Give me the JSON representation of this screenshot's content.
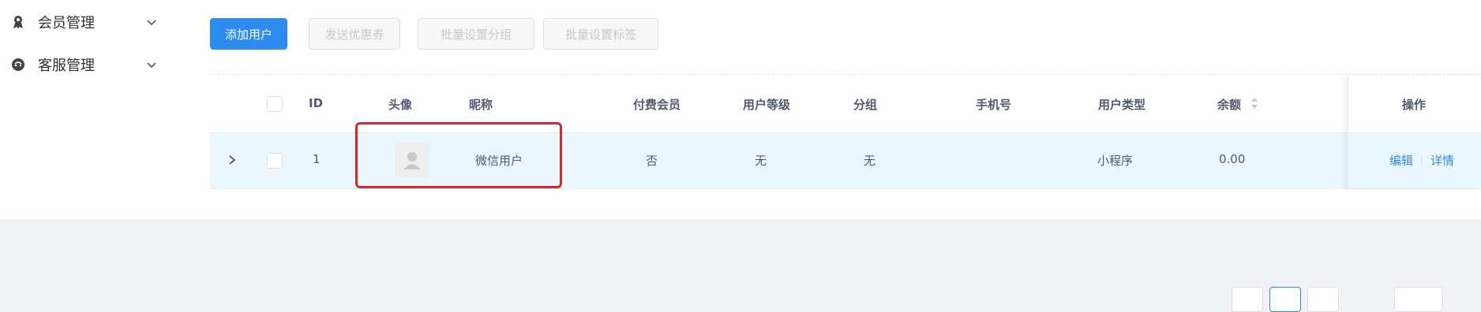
{
  "sidebar": {
    "items": [
      {
        "label": "会员管理",
        "icon": "medal-icon"
      },
      {
        "label": "客服管理",
        "icon": "chat-icon"
      }
    ]
  },
  "toolbar": {
    "add_user": "添加用户",
    "send_coupon": "发送优惠券",
    "batch_group": "批量设置分组",
    "batch_tag": "批量设置标签"
  },
  "table": {
    "headers": {
      "id": "ID",
      "avatar": "头像",
      "nickname": "昵称",
      "paid_member": "付费会员",
      "level": "用户等级",
      "group": "分组",
      "phone": "手机号",
      "user_type": "用户类型",
      "balance": "余额",
      "actions": "操作"
    },
    "rows": [
      {
        "id": "1",
        "nickname": "微信用户",
        "paid_member": "否",
        "level": "无",
        "group": "无",
        "phone": "",
        "user_type": "小程序",
        "balance": "0.00",
        "edit": "编辑",
        "detail": "详情"
      }
    ]
  },
  "colors": {
    "primary": "#2d8cf0",
    "row_highlight": "#ebf7ff",
    "annotation": "#e02424"
  }
}
